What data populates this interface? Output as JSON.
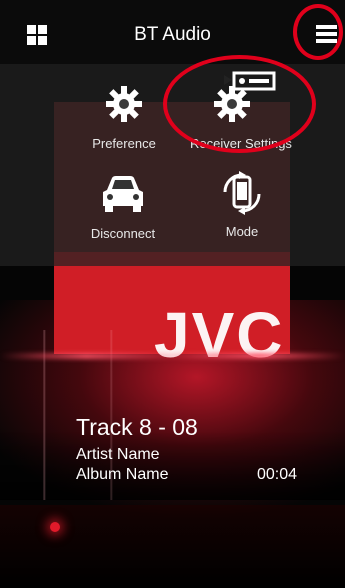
{
  "header": {
    "title": "BT Audio",
    "left_icon": "grid-icon",
    "right_icon": "hamburger-menu-icon"
  },
  "menu": {
    "items": [
      {
        "label": "Preference",
        "icon": "gear-icon"
      },
      {
        "label": "Receiver Settings",
        "icon": "receiver-gear-icon"
      },
      {
        "label": "Disconnect",
        "icon": "car-icon"
      },
      {
        "label": "Mode",
        "icon": "phone-rotate-icon"
      }
    ]
  },
  "album_art": {
    "logo_text": "JVC"
  },
  "now_playing": {
    "track": "Track  8 - 08",
    "artist": "Artist Name",
    "album": "Album Name",
    "elapsed": "00:04"
  },
  "colors": {
    "accent_red": "#e0001b",
    "album_red": "#d01e26"
  }
}
